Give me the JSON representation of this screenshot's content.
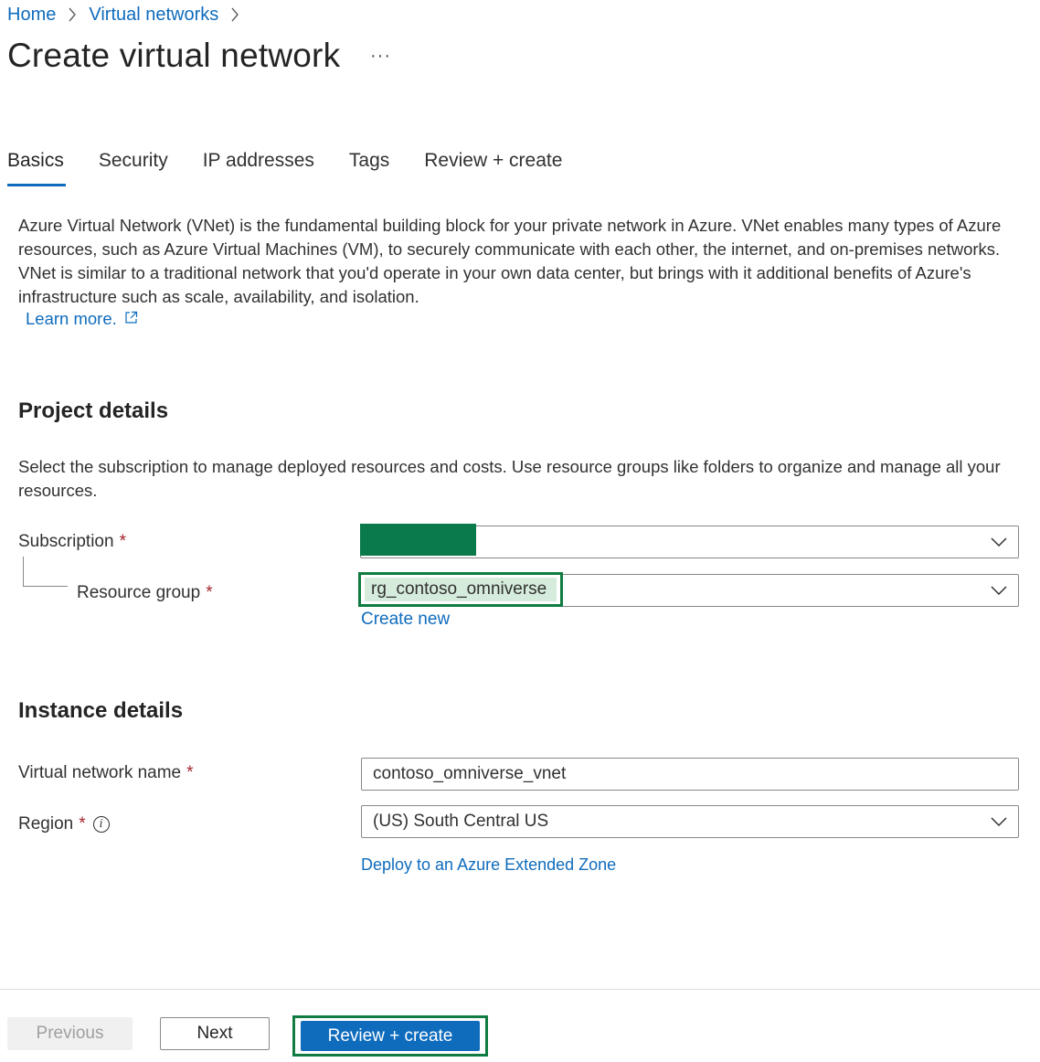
{
  "breadcrumb": [
    {
      "label": "Home"
    },
    {
      "label": "Virtual networks"
    }
  ],
  "page": {
    "title": "Create virtual network",
    "more_label": "···"
  },
  "tabs": [
    {
      "label": "Basics",
      "active": true
    },
    {
      "label": "Security",
      "active": false
    },
    {
      "label": "IP addresses",
      "active": false
    },
    {
      "label": "Tags",
      "active": false
    },
    {
      "label": "Review + create",
      "active": false
    }
  ],
  "intro": {
    "text": "Azure Virtual Network (VNet) is the fundamental building block for your private network in Azure. VNet enables many types of Azure resources, such as Azure Virtual Machines (VM), to securely communicate with each other, the internet, and on-premises networks. VNet is similar to a traditional network that you'd operate in your own data center, but brings with it additional benefits of Azure's infrastructure such as scale, availability, and isolation.",
    "learn_more": "Learn more.",
    "learn_more_icon": "external-link-icon"
  },
  "project": {
    "title": "Project details",
    "description": "Select the subscription to manage deployed resources and costs. Use resource groups like folders to organize and manage all your resources.",
    "subscription_label": "Subscription",
    "subscription_value": "",
    "resource_group_label": "Resource group",
    "resource_group_value": "rg_contoso_omniverse",
    "create_new": "Create new",
    "required_mark": "*"
  },
  "instance": {
    "title": "Instance details",
    "vnet_name_label": "Virtual network name",
    "vnet_name_value": "contoso_omniverse_vnet",
    "region_label": "Region",
    "region_value": "(US) South Central US",
    "extended_zone_link": "Deploy to an Azure Extended Zone",
    "info_icon": "info-icon"
  },
  "footer": {
    "previous": "Previous",
    "next": "Next",
    "review_create": "Review + create"
  },
  "colors": {
    "link": "#0f6cbd",
    "primary_button": "#0f6cbd",
    "highlight_border": "#107c41",
    "highlight_fill": "#d5ecdc",
    "redaction": "#0b7a4a",
    "required": "#a4262c",
    "disabled_button": "#f0f0f0"
  }
}
